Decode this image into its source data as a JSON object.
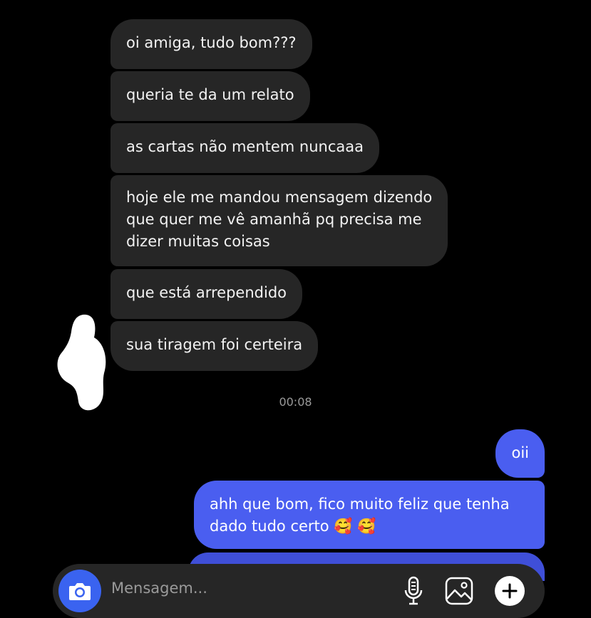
{
  "conversation": {
    "incoming": [
      {
        "text": "oi amiga, tudo bom???"
      },
      {
        "text": "queria te da um relato"
      },
      {
        "text": "as cartas não mentem nuncaaa"
      },
      {
        "lines": [
          "hoje ele me mandou mensagem dizendo",
          "que quer me vê amanhã pq precisa me",
          "dizer muitas coisas"
        ]
      },
      {
        "text": "que está arrependido"
      },
      {
        "text": "sua tiragem foi certeira"
      }
    ],
    "timestamp": "00:08",
    "outgoing": [
      {
        "text": "oii"
      },
      {
        "lines": [
          "ahh que bom, fico muito feliz que tenha",
          "dado tudo certo 🥰 🥰"
        ]
      }
    ]
  },
  "composer": {
    "placeholder": "Mensagem...",
    "icons": [
      "camera-icon",
      "microphone-icon",
      "image-icon",
      "plus-icon"
    ]
  },
  "colors": {
    "background": "#000000",
    "incoming_bubble": "#262626",
    "outgoing_bubble": "#4a5ef0",
    "camera_button": "#3a63f0"
  }
}
